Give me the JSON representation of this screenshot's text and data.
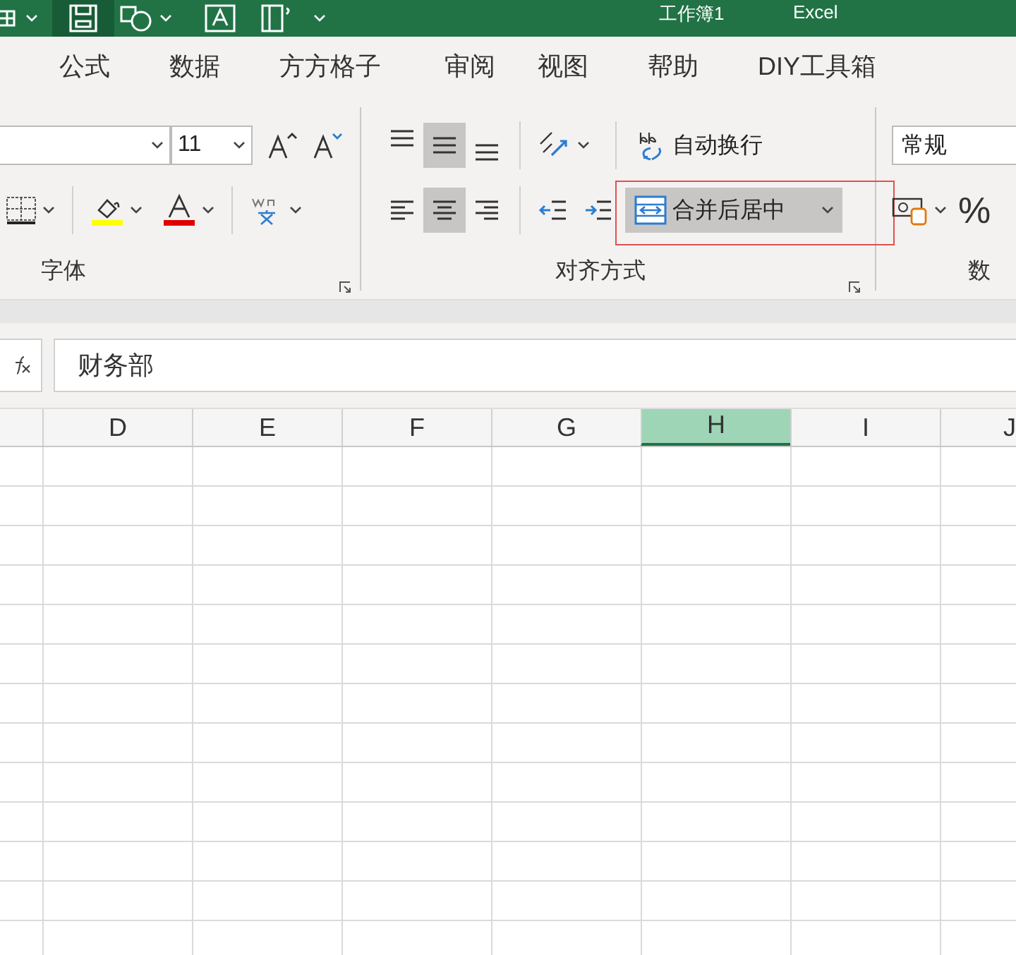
{
  "title_bar": {
    "title": "工作簿1",
    "app": "Excel"
  },
  "menu_tabs": [
    {
      "label": "公式",
      "selected": false
    },
    {
      "label": "数据",
      "selected": false
    },
    {
      "label": "方方格子",
      "selected": false
    },
    {
      "label": "审阅",
      "selected": false
    },
    {
      "label": "视图",
      "selected": false
    },
    {
      "label": "帮助",
      "selected": false
    },
    {
      "label": "DIY工具箱",
      "selected": false
    }
  ],
  "ribbon": {
    "font": {
      "font_size": "11",
      "label": "字体"
    },
    "alignment": {
      "vertical": [
        {
          "kind": "top",
          "selected": false
        },
        {
          "kind": "middle",
          "selected": true
        },
        {
          "kind": "bottom",
          "selected": false
        }
      ],
      "horizontal": [
        {
          "kind": "left",
          "selected": false
        },
        {
          "kind": "center",
          "selected": true
        },
        {
          "kind": "right",
          "selected": false
        }
      ],
      "wrap_text": {
        "label": "自动换行"
      },
      "merge": {
        "label": "合并后居中",
        "selected": true,
        "highlighted": true
      },
      "label": "对齐方式"
    },
    "number": {
      "format": "常规",
      "percent": "%",
      "label": "数"
    }
  },
  "formula_bar": {
    "value": "财务部"
  },
  "sheet": {
    "columns": [
      {
        "label": "D",
        "selected": false
      },
      {
        "label": "E",
        "selected": false
      },
      {
        "label": "F",
        "selected": false
      },
      {
        "label": "G",
        "selected": false
      },
      {
        "label": "H",
        "selected": true
      },
      {
        "label": "I",
        "selected": false
      },
      {
        "label": "J",
        "selected": false
      }
    ]
  }
}
